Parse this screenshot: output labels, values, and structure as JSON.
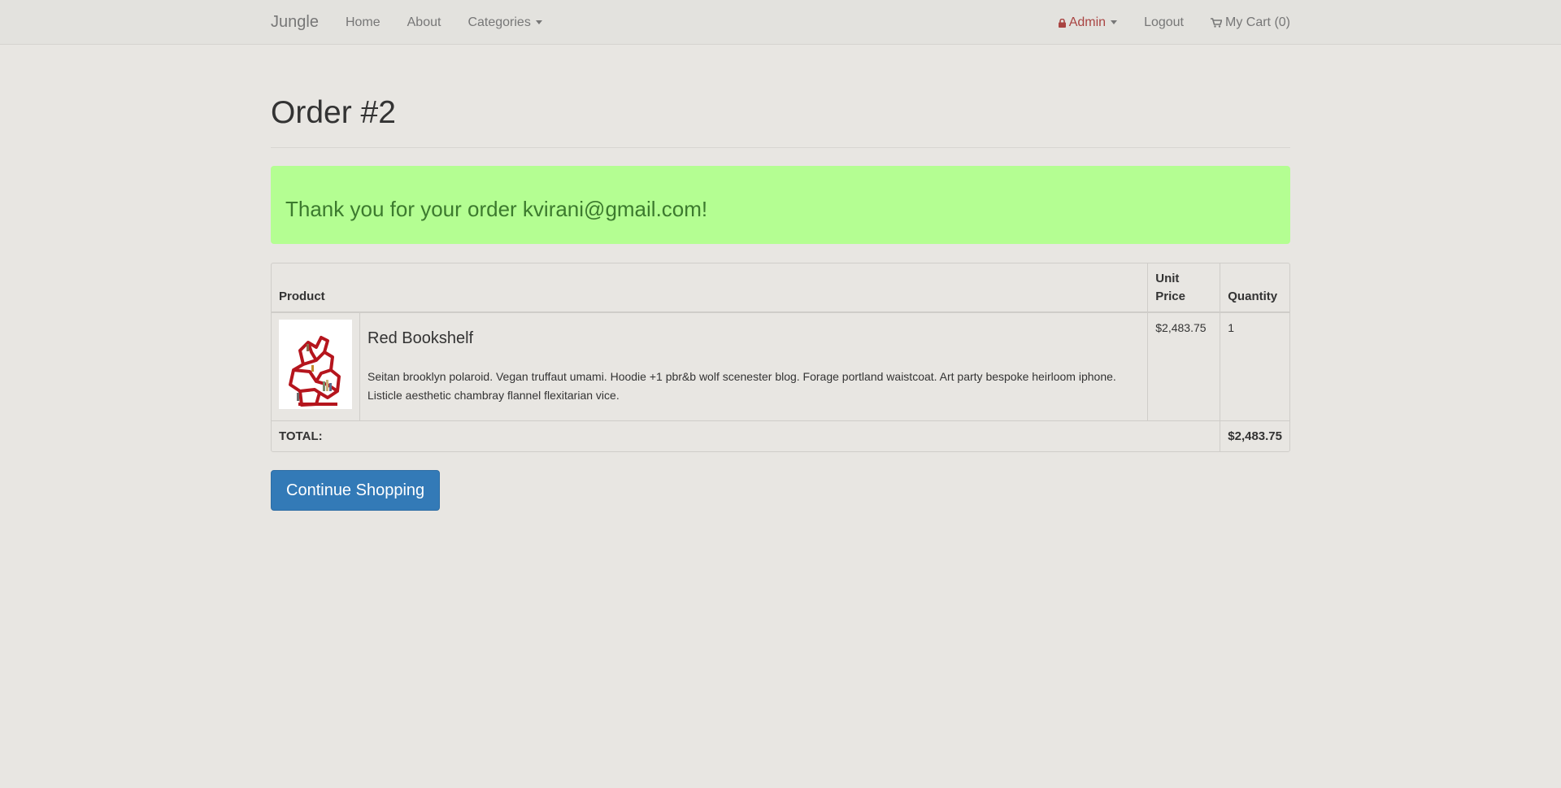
{
  "nav": {
    "brand": "Jungle",
    "home": "Home",
    "about": "About",
    "categories": "Categories",
    "admin": "Admin",
    "logout": "Logout",
    "cart": "My Cart (0)",
    "admin_color": "#a94442"
  },
  "page": {
    "title": "Order #2",
    "alert": "Thank you for your order kvirani@gmail.com!",
    "alert_bg": "#b4fe92"
  },
  "table": {
    "headers": {
      "product": "Product",
      "unit_price": "Unit Price",
      "quantity": "Quantity"
    },
    "rows": [
      {
        "name": "Red Bookshelf",
        "description": "Seitan brooklyn polaroid. Vegan truffaut umami. Hoodie +1 pbr&b wolf scenester blog. Forage portland waistcoat. Art party bespoke heirloom iphone. Listicle aesthetic chambray flannel flexitarian vice.",
        "unit_price": "$2,483.75",
        "quantity": "1"
      }
    ],
    "total_label": "TOTAL:",
    "total_value": "$2,483.75"
  },
  "actions": {
    "continue": "Continue Shopping",
    "continue_color": "#337ab7"
  }
}
